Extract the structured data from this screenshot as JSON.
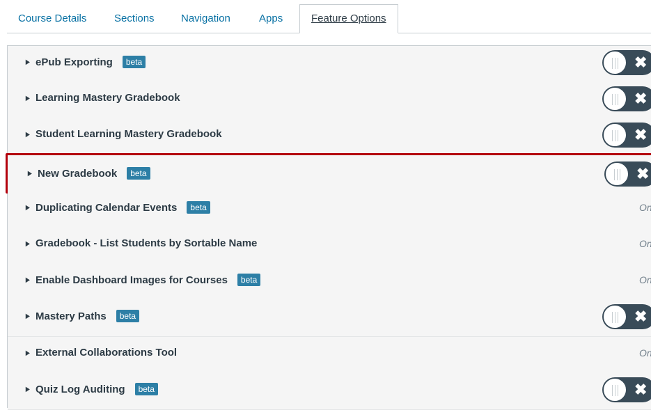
{
  "tabs": [
    {
      "label": "Course Details"
    },
    {
      "label": "Sections"
    },
    {
      "label": "Navigation"
    },
    {
      "label": "Apps"
    },
    {
      "label": "Feature Options",
      "active": true
    }
  ],
  "features": [
    {
      "name": "ePub Exporting",
      "beta": "beta",
      "control": "toggle",
      "toggle_icon": "x-icon",
      "state": "off"
    },
    {
      "name": "Learning Mastery Gradebook",
      "beta": null,
      "control": "toggle",
      "toggle_icon": "x-icon",
      "state": "off"
    },
    {
      "name": "Student Learning Mastery Gradebook",
      "beta": null,
      "control": "toggle",
      "toggle_icon": "x-icon",
      "state": "off"
    },
    {
      "name": "New Gradebook",
      "beta": "beta",
      "control": "toggle",
      "toggle_icon": "x-icon",
      "state": "off",
      "highlighted": true
    },
    {
      "name": "Duplicating Calendar Events",
      "beta": "beta",
      "control": "text",
      "status_text": "On"
    },
    {
      "name": "Gradebook - List Students by Sortable Name",
      "beta": null,
      "control": "text",
      "status_text": "On"
    },
    {
      "name": "Enable Dashboard Images for Courses",
      "beta": "beta",
      "control": "text",
      "status_text": "On"
    },
    {
      "name": "Mastery Paths",
      "beta": "beta",
      "control": "toggle",
      "toggle_icon": "x-icon",
      "state": "off"
    },
    {
      "name": "External Collaborations Tool",
      "beta": null,
      "control": "text",
      "status_text": "On"
    },
    {
      "name": "Quiz Log Auditing",
      "beta": "beta",
      "control": "toggle",
      "toggle_icon": "x-icon",
      "state": "off"
    }
  ],
  "colors": {
    "link": "#0770a3",
    "beta_badge": "#2d7fa6",
    "toggle_off": "#394b58",
    "highlight": "#b3000c"
  }
}
